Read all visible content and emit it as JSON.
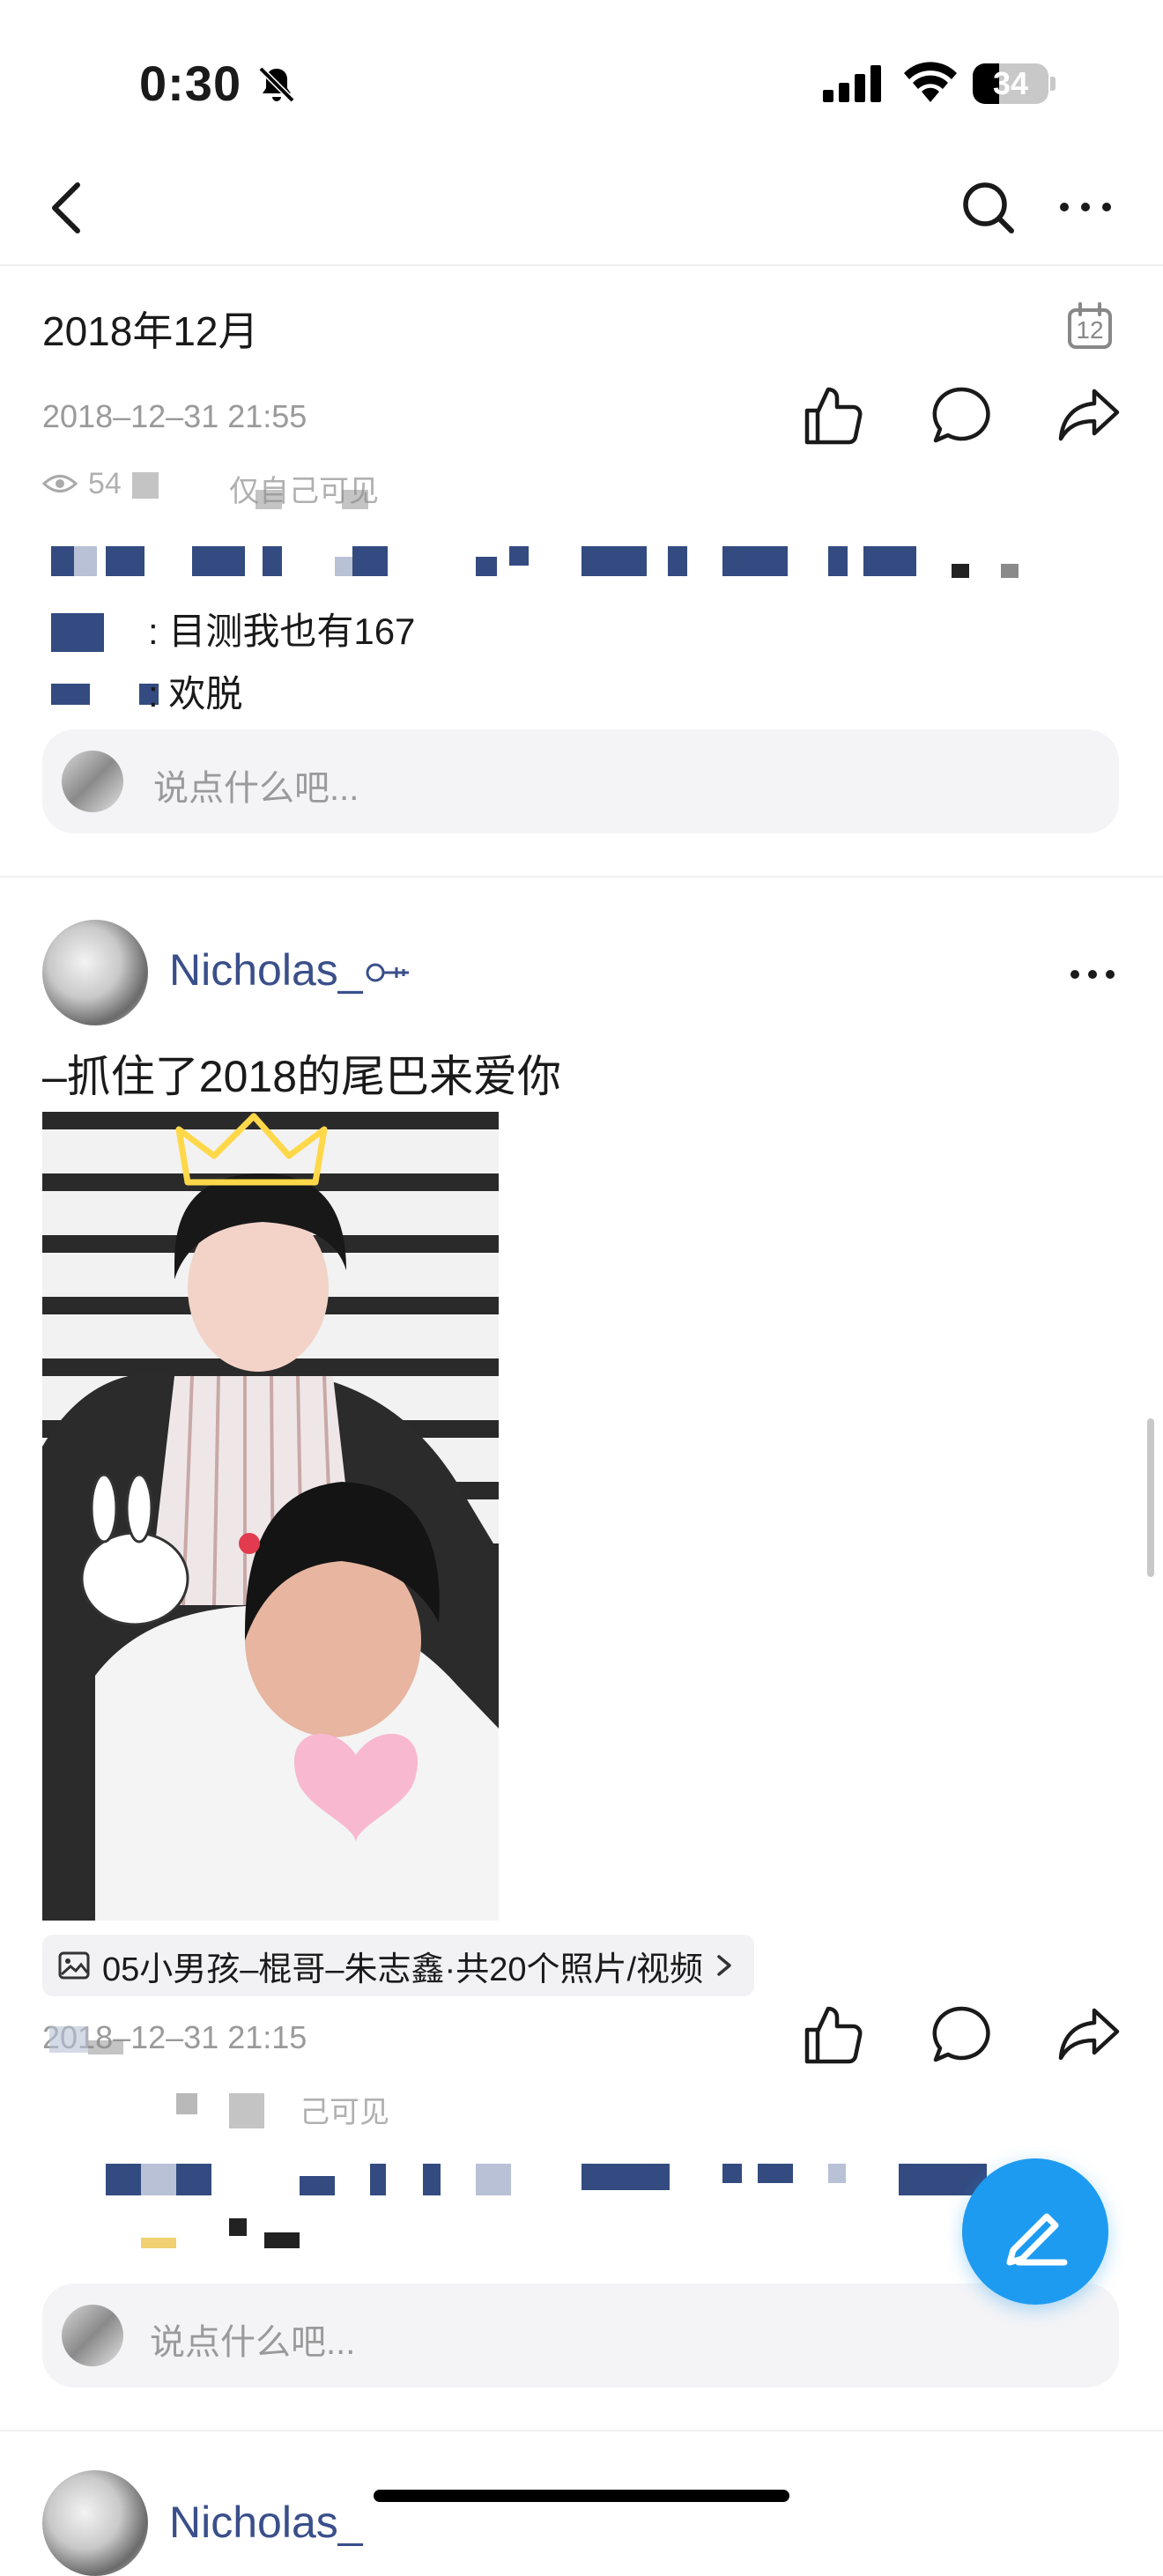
{
  "status_bar": {
    "time": "0:30",
    "battery": "34"
  },
  "nav": {
    "back_icon": "chevron-left-icon",
    "search_icon": "search-icon",
    "more_icon": "more-horizontal-icon"
  },
  "month_header": {
    "label": "2018年12月",
    "calendar_day": "12"
  },
  "post1": {
    "timestamp": "2018–12–31 21:55",
    "views_partial": "54",
    "visibility_partial": "仅自己可见",
    "comments": [
      {
        "text": ": 目测我也有167"
      },
      {
        "text": ": 欢脱"
      }
    ],
    "comment_placeholder": "说点什么吧..."
  },
  "post2": {
    "username": "Nicholas_",
    "text": "–抓住了2018的尾巴来爱你",
    "album_label": "05小男孩–棍哥–朱志鑫·共20个照片/视频",
    "timestamp_partial": "2018–12–31 21:15",
    "visibility_partial": "己可见",
    "comment_placeholder": "说点什么吧..."
  },
  "post3": {
    "username": "Nicholas_"
  },
  "colors": {
    "accent": "#1d9bf0",
    "username": "#3a4f8a",
    "meta": "#9a9a9a"
  }
}
